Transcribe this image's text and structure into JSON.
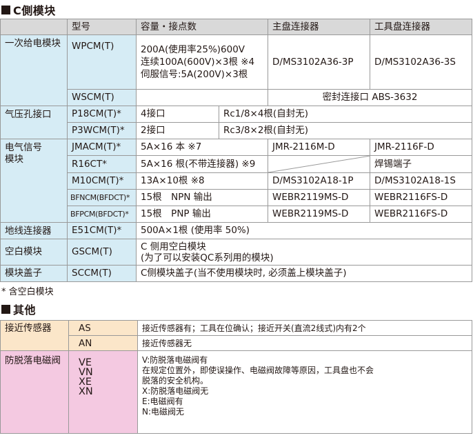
{
  "section1": {
    "title": "C側模块",
    "headers": [
      "",
      "型号",
      "容量・接点数",
      "主盘连接器",
      "工具盘连接器"
    ],
    "power": {
      "category": "一次给电模块",
      "model1": "WPCM(T)",
      "model2": "WSCM(T)",
      "capacity": [
        "200A(使用率25%)600V",
        "连续100A(600V)×3根 ※4",
        "伺服信号:5A(200V)×3根"
      ],
      "master1": "D/MS3102A36-3P",
      "tool1": "D/MS3102A36-3S",
      "sealed": "密封连接口 ABS-3632"
    },
    "air": {
      "category": "气压孔接口",
      "rows": [
        {
          "model": "P18CM(T)*",
          "ports": "4接口",
          "spec": "Rc1/8×4根(自封无)"
        },
        {
          "model": "P3WCM(T)*",
          "ports": "2接口",
          "spec": "Rc3/8×2根(自封无)"
        }
      ]
    },
    "signal": {
      "category": [
        "电气信号",
        "模块"
      ],
      "rows": [
        {
          "model": "JMACM(T)*",
          "capacity": "5A×16 本 ※7",
          "master": "JMR-2116M-D",
          "tool": "JMR-2116F-D"
        },
        {
          "model": "R16CT*",
          "capacity": "5A×16 根(不带连接器) ※9",
          "master": "",
          "tool": "焊锡端子"
        },
        {
          "model": "M10CM(T)*",
          "capacity": "13A×10根 ※8",
          "master": "D/MS3102A18-1P",
          "tool": "D/MS3102A18-1S"
        },
        {
          "model": "BFNCM(BFDCT)*",
          "capacity": "15根　NPN 输出",
          "master": "WEBR2119MS-D",
          "tool": "WEBR2116FS-D"
        },
        {
          "model": "BFPCM(BFDCT)*",
          "capacity": "15根　PNP 输出",
          "master": "WEBR2119MS-D",
          "tool": "WEBR2116FS-D"
        }
      ]
    },
    "ground": {
      "category": "地线连接器",
      "model": "E51CM(T)*",
      "capacity": "500A×1根 (使用率 50%)"
    },
    "blank": {
      "category": "空白模块",
      "model": "GSCM(T)",
      "capacity": [
        "C 侧用空白模块",
        "(为了可以安装QC系列用的模块)"
      ]
    },
    "cover": {
      "category": "模块盖子",
      "model": "SCCM(T)",
      "capacity": "C侧模块盖子(当不使用模块时, 必须盖上模块盖子)"
    }
  },
  "note": "* 含空白模块",
  "section2": {
    "title": "其他",
    "proximity": {
      "category": "接近传感器",
      "rows": [
        {
          "code": "AS",
          "desc": "接近传感器有；工具在位确认；接近开关(直流2线式)内有2个"
        },
        {
          "code": "AN",
          "desc": "接近传感器无"
        }
      ]
    },
    "valve": {
      "category": "防脱落电磁阀",
      "codes": [
        "VE",
        "VN",
        "XE",
        "XN"
      ],
      "desc": [
        "V:防脱落电磁阀有",
        "在规定位置外，即使误操作、电磁阀故障等原因，工具盘也不会",
        "脱落的安全机构。",
        "X:防脱落电磁阀无",
        "E:电磁阀有",
        "N:电磁阀无"
      ]
    }
  }
}
